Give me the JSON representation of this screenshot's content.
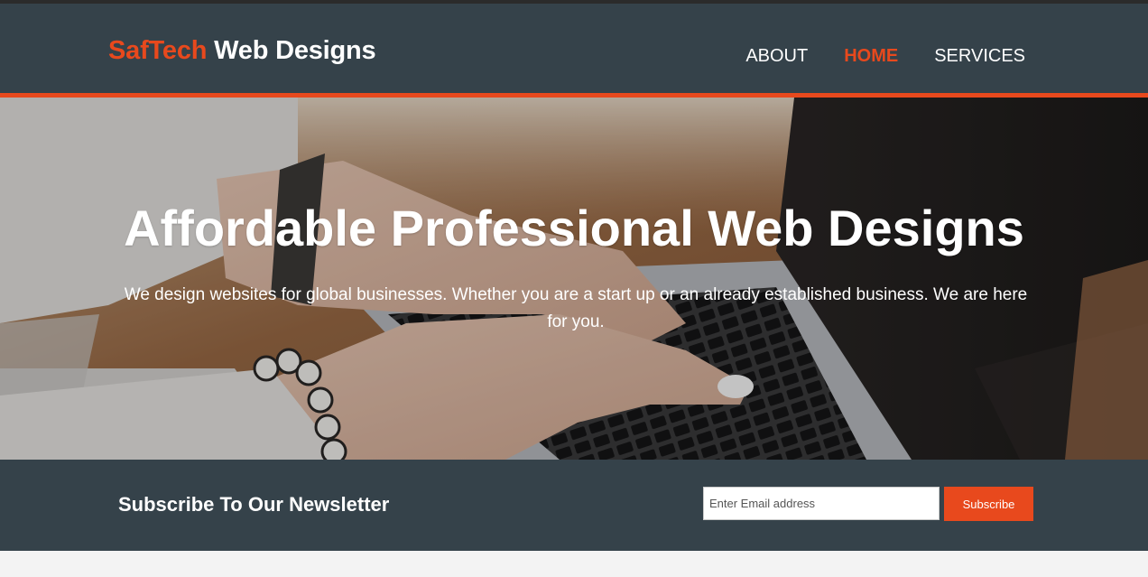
{
  "header": {
    "brand_highlight": "SafTech",
    "brand_rest": " Web Designs",
    "nav": [
      {
        "label": "About",
        "current": false
      },
      {
        "label": "Home",
        "current": true
      },
      {
        "label": "Services",
        "current": false
      }
    ]
  },
  "showcase": {
    "title": "Affordable Professional Web Designs",
    "text": "We design websites for global businesses. Whether you are a start up or an already established business. We are here for you."
  },
  "newsletter": {
    "heading": "Subscribe To Our Newsletter",
    "email_placeholder": "Enter Email address",
    "email_value": "",
    "subscribe_label": "Subscribe"
  },
  "colors": {
    "header_bg": "#35424a",
    "accent": "#e8491d",
    "text_light": "#ffffff",
    "page_bg": "#f3f3f3"
  }
}
